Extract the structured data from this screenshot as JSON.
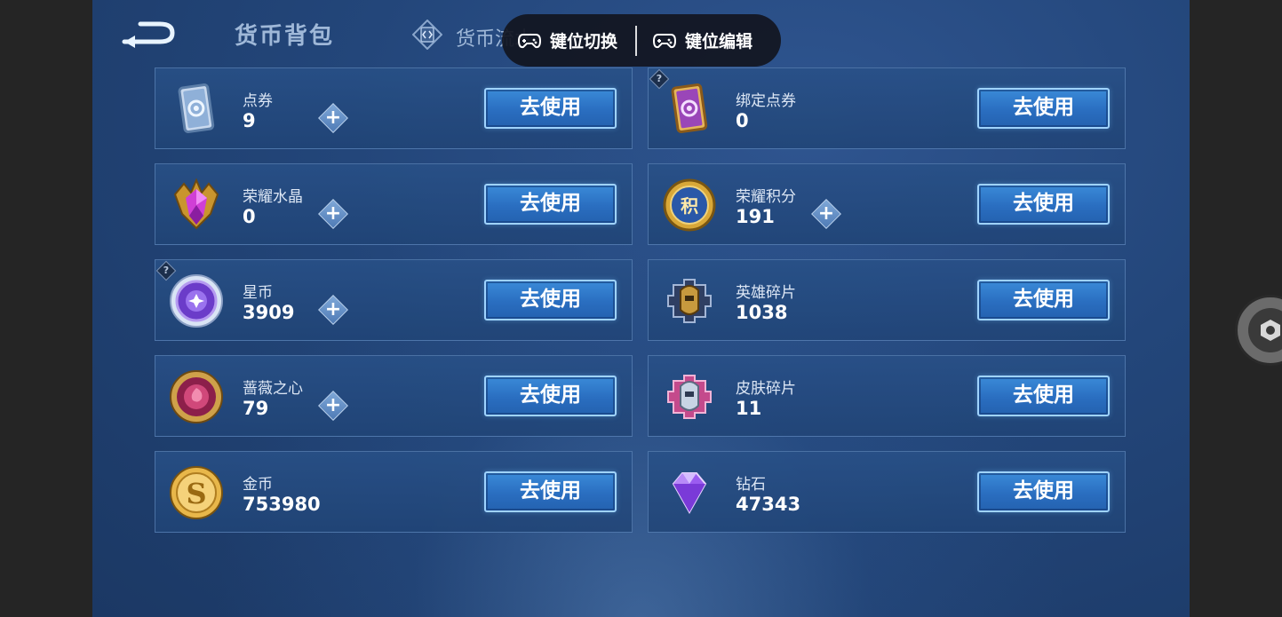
{
  "header": {
    "title": "货币背包",
    "flow_tab_label": "货币流水"
  },
  "overlay": {
    "key_switch_label": "键位切换",
    "key_edit_label": "键位编辑"
  },
  "use_label": "去使用",
  "plus_label": "+",
  "help_mark": "?",
  "currencies": [
    {
      "name": "点券",
      "value": "9",
      "icon": "voucher-card-icon"
    },
    {
      "name": "绑定点券",
      "value": "0",
      "icon": "bound-voucher-card-icon"
    },
    {
      "name": "荣耀水晶",
      "value": "0",
      "icon": "glory-crystal-icon"
    },
    {
      "name": "荣耀积分",
      "value": "191",
      "icon": "glory-points-icon"
    },
    {
      "name": "星币",
      "value": "3909",
      "icon": "star-coin-icon"
    },
    {
      "name": "英雄碎片",
      "value": "1038",
      "icon": "hero-fragment-icon"
    },
    {
      "name": "蔷薇之心",
      "value": "79",
      "icon": "rose-heart-icon"
    },
    {
      "name": "皮肤碎片",
      "value": "11",
      "icon": "skin-fragment-icon"
    },
    {
      "name": "金币",
      "value": "753980",
      "icon": "gold-coin-icon"
    },
    {
      "name": "钻石",
      "value": "47343",
      "icon": "diamond-icon"
    }
  ],
  "colors": {
    "button_blue": "#2a6ec0",
    "panel_bg": "#23467a",
    "overlay_bg": "#12161f"
  }
}
